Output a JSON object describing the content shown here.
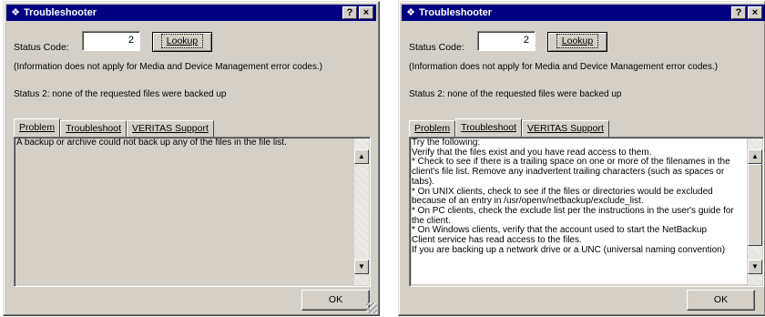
{
  "colors": {
    "face": "#d4d0c8",
    "titlebar": "#000080",
    "paper": "#ffffff"
  },
  "windows": [
    {
      "title": "Troubleshooter",
      "title_icon": "troubleshooter-icon",
      "help_label": "?",
      "close_label": "×",
      "status_code_label": "Status Code:",
      "status_code_value": "2",
      "lookup_label": "Lookup",
      "info": "(Information does not apply for Media and Device Management error codes.)",
      "status_message": "Status 2: none of the requested files were backed up",
      "tabs": [
        {
          "label": "Problem",
          "active": true
        },
        {
          "label": "Troubleshoot",
          "active": false
        },
        {
          "label": "VERITAS Support",
          "active": false
        }
      ],
      "pane_lines": [
        "A backup or archive could not back up any of the files in the file list."
      ],
      "ok_label": "OK"
    },
    {
      "title": "Troubleshooter",
      "title_icon": "troubleshooter-icon",
      "help_label": "?",
      "close_label": "×",
      "status_code_label": "Status Code:",
      "status_code_value": "2",
      "lookup_label": "Lookup",
      "info": "(Information does not apply for Media and Device Management error codes.)",
      "status_message": "Status 2: none of the requested files were backed up",
      "tabs": [
        {
          "label": "Problem",
          "active": false
        },
        {
          "label": "Troubleshoot",
          "active": true
        },
        {
          "label": "VERITAS Support",
          "active": false
        }
      ],
      "pane_lines": [
        "Try the following:",
        "Verify that the files exist and you have read access to them.",
        "* Check to see if there is a trailing space on one or more of the filenames in the",
        "client's file list. Remove any inadvertent trailing characters (such as spaces or",
        "tabs).",
        "* On UNIX clients, check to see if the files or directories would be excluded",
        "because of an entry in /usr/openv/netbackup/exclude_list.",
        "* On PC clients, check the exclude list per the instructions in the user's guide for",
        "the client.",
        "* On Windows clients, verify that the account used to start the NetBackup",
        "Client service has read access to the files.",
        "  If you are backing up a network drive or a UNC (universal naming convention)"
      ],
      "ok_label": "OK"
    }
  ]
}
